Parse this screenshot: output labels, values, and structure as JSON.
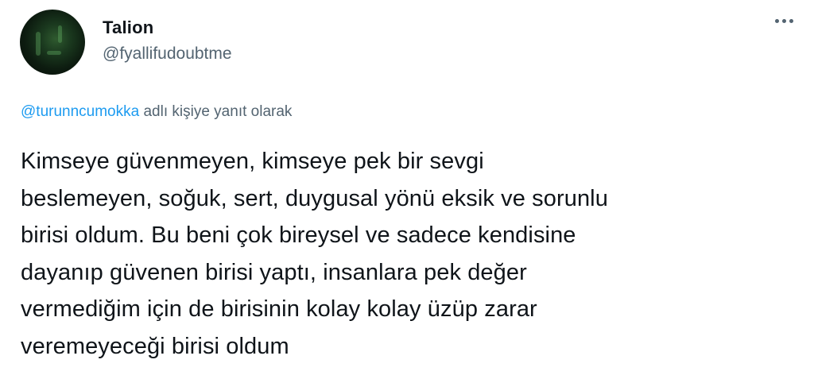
{
  "author": {
    "display_name": "Talion",
    "handle": "@fyallifudoubtme"
  },
  "menu": {
    "icon": "more-horizontal-icon"
  },
  "reply": {
    "mention": "@turunncumokka",
    "suffix": " adlı kişiye yanıt olarak"
  },
  "tweet": {
    "text": "Kimseye güvenmeyen, kimseye pek bir sevgi\nbeslemeyen, soğuk, sert, duygusal yönü eksik ve sorunlu\nbirisi oldum. Bu beni çok bireysel ve sadece kendisine\ndayanıp güvenen birisi yaptı, insanlara pek değer\nvermediğim için de birisinin kolay kolay üzüp zarar\nveremeyeceği birisi oldum"
  },
  "colors": {
    "text_primary": "#0f1419",
    "text_secondary": "#536471",
    "link": "#1d9bf0"
  }
}
